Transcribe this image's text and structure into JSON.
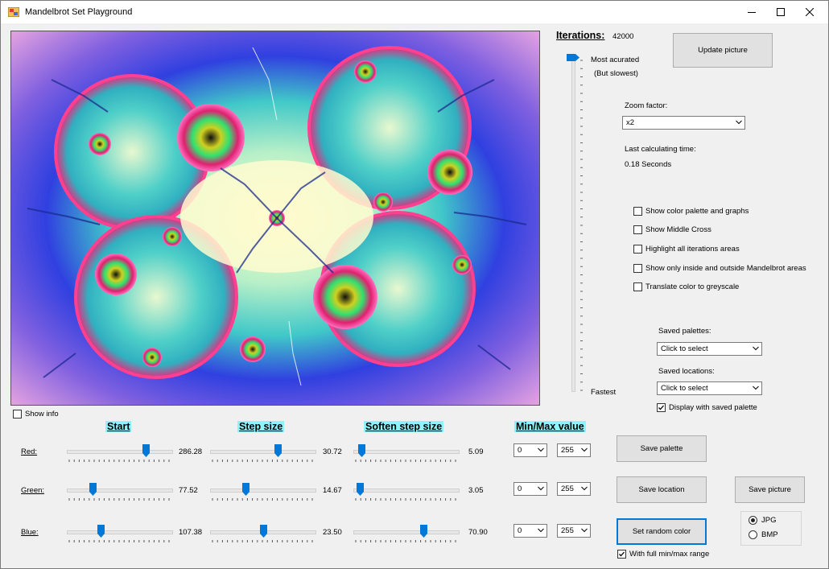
{
  "window": {
    "title": "Mandelbrot Set Playground"
  },
  "iterations": {
    "label": "Iterations:",
    "value": "42000",
    "top_label": "Most acurated",
    "top_sublabel": "(But slowest)",
    "bottom_label": "Fastest",
    "level": 1.0
  },
  "update_button": "Update picture",
  "zoom": {
    "label": "Zoom factor:",
    "value": "x2"
  },
  "last_calc": {
    "label": "Last calculating time:",
    "value": "0.18 Seconds"
  },
  "options": [
    {
      "label": "Show color palette and graphs",
      "checked": false
    },
    {
      "label": "Show Middle Cross",
      "checked": false
    },
    {
      "label": "Highlight all iterations areas",
      "checked": false
    },
    {
      "label": "Show only inside and outside Mandelbrot areas",
      "checked": false
    },
    {
      "label": "Translate color to greyscale",
      "checked": false
    }
  ],
  "saved_palettes": {
    "label": "Saved palettes:",
    "value": "Click to select"
  },
  "saved_locations": {
    "label": "Saved locations:",
    "value": "Click to select"
  },
  "display_saved_palette": {
    "label": "Display with saved palette",
    "checked": true
  },
  "show_info": {
    "label": "Show info",
    "checked": false
  },
  "headers": {
    "start": "Start",
    "step": "Step size",
    "soften": "Soften step size",
    "minmax": "Min/Max value"
  },
  "rows": [
    {
      "label": "Red:",
      "start": "286.28",
      "start_pos": 0.78,
      "step": "30.72",
      "step_pos": 0.66,
      "soften": "5.09",
      "soften_pos": 0.05,
      "min": "0",
      "max": "255"
    },
    {
      "label": "Green:",
      "start": "77.52",
      "start_pos": 0.23,
      "step": "14.67",
      "step_pos": 0.33,
      "soften": "3.05",
      "soften_pos": 0.03,
      "min": "0",
      "max": "255"
    },
    {
      "label": "Blue:",
      "start": "107.38",
      "start_pos": 0.31,
      "step": "23.50",
      "step_pos": 0.51,
      "soften": "70.90",
      "soften_pos": 0.69,
      "min": "0",
      "max": "255"
    }
  ],
  "buttons": {
    "save_palette": "Save  palette",
    "save_location": "Save location",
    "save_picture": "Save picture",
    "random_color": "Set random color"
  },
  "full_range": {
    "label": "With full min/max range",
    "checked": true
  },
  "format": {
    "options": [
      "JPG",
      "BMP"
    ],
    "selected": "JPG"
  },
  "colors": {
    "highlight": "#8ff2ff",
    "slider_thumb": "#0078d7",
    "focus": "#0078d7"
  }
}
